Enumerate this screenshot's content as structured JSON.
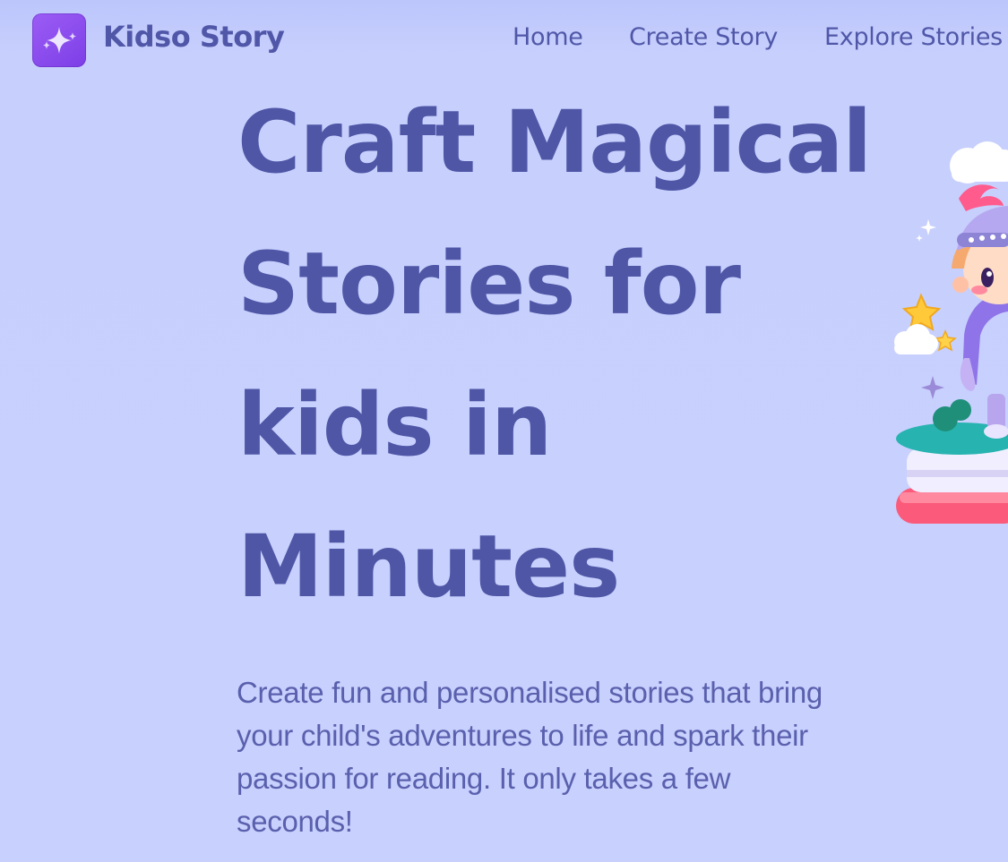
{
  "brand": {
    "name": "Kidso Story",
    "logo_icon": "sparkle-icon",
    "logo_color": "#8b4cf0"
  },
  "nav": {
    "items": [
      {
        "label": "Home"
      },
      {
        "label": "Create Story"
      },
      {
        "label": "Explore Stories"
      }
    ]
  },
  "hero": {
    "title_lines": [
      "Craft Magical",
      "Stories for",
      "kids in",
      "Minutes"
    ],
    "description": "Create fun and personalised stories that bring your child's adventures to life and spark their passion for reading. It only takes a few seconds!"
  },
  "illustration": {
    "icon": "knight-on-book-illustration"
  },
  "colors": {
    "background": "#c7cffc",
    "text": "#5157a8",
    "accent": "#8b4cf0",
    "book_red": "#fc5a7a"
  }
}
